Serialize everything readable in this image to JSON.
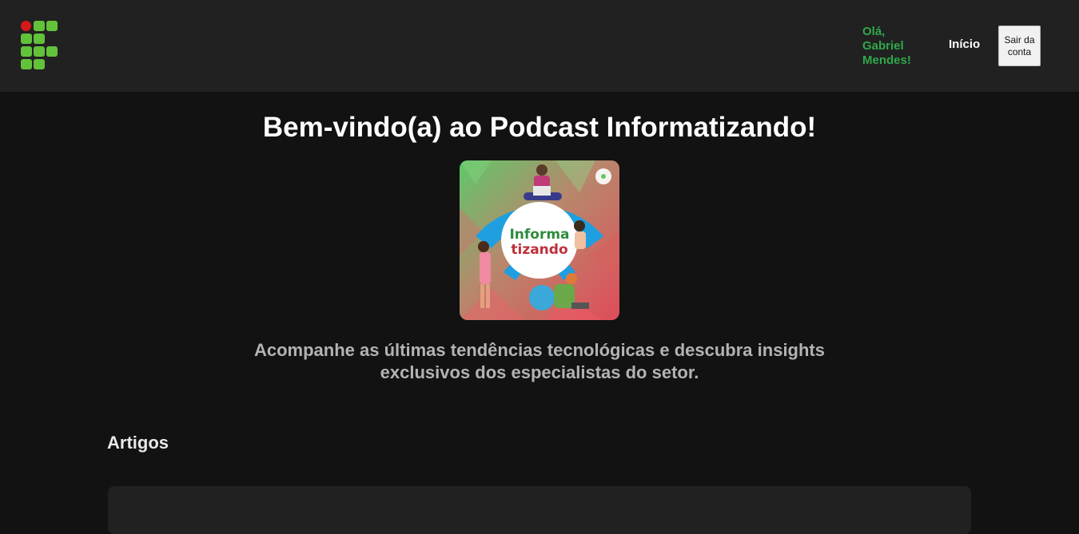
{
  "header": {
    "logo_name": "if-logo",
    "greeting": "Olá, Gabriel Mendes!",
    "nav_home": "Início",
    "logout_label": "Sair da conta"
  },
  "main": {
    "title": "Bem-vindo(a) ao Podcast Informatizando!",
    "cover_text_line1": "Informa",
    "cover_text_line2": "tizando",
    "tagline": "Acompanhe as últimas tendências tecnológicas e descubra insights exclusivos dos especialistas do setor.",
    "articles_heading": "Artigos"
  },
  "colors": {
    "topbar_bg": "#212121",
    "page_bg": "#121212",
    "greeting": "#2fa84a",
    "logo_green": "#62c23a",
    "logo_red": "#d31919"
  }
}
